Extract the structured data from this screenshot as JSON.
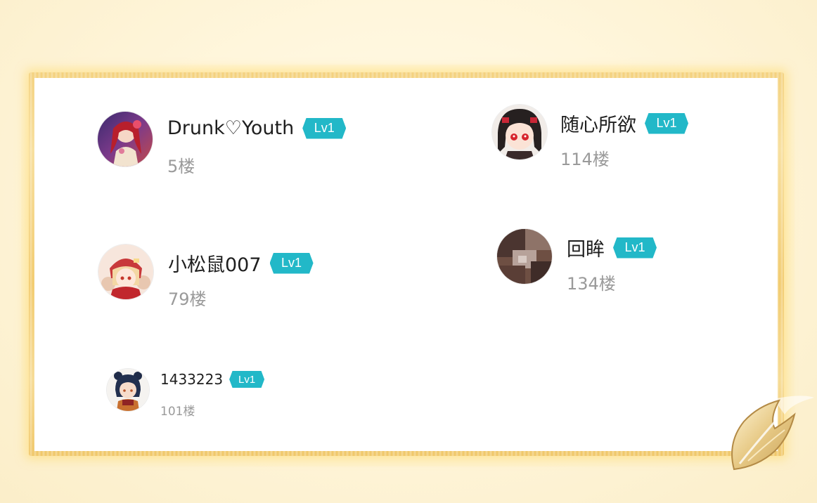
{
  "users": [
    {
      "name": "Drunk♡Youth",
      "level": "Lv1",
      "floor": "5楼",
      "avatar": "avatar-red-hair-girl"
    },
    {
      "name": "随心所欲",
      "level": "Lv1",
      "floor": "114楼",
      "avatar": "avatar-chibi-black-hair"
    },
    {
      "name": "小松鼠007",
      "level": "Lv1",
      "floor": "79楼",
      "avatar": "avatar-klee"
    },
    {
      "name": "回眸",
      "level": "Lv1",
      "floor": "134楼",
      "avatar": "avatar-blurred-photo"
    },
    {
      "name": "1433223",
      "level": "Lv1",
      "floor": "101楼",
      "avatar": "avatar-xiangling"
    }
  ],
  "colors": {
    "badge": "#22b8c8",
    "name": "#1f1f1f",
    "floor": "#9a9a9a",
    "frame_gold": "#f1c866"
  }
}
